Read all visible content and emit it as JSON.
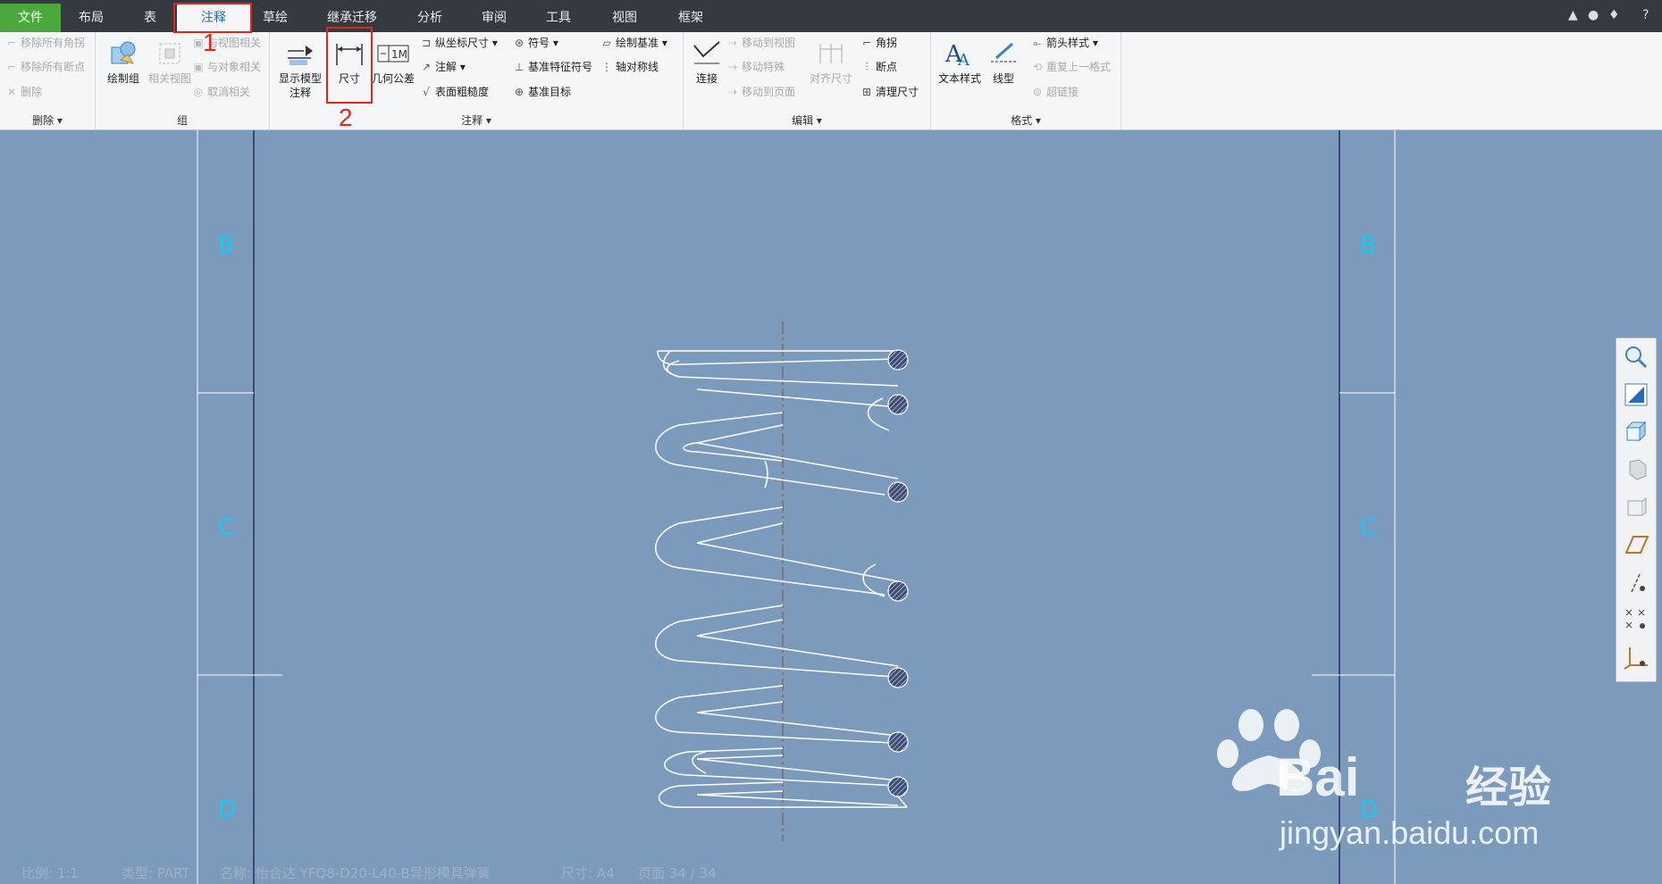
{
  "tabs": [
    "文件",
    "布局",
    "表",
    "注释",
    "草绘",
    "继承迁移",
    "分析",
    "审阅",
    "工具",
    "视图",
    "框架"
  ],
  "window_controls": [
    "▲",
    "●",
    "♦",
    "?"
  ],
  "ribbon": {
    "delete_group": {
      "label": "删除 ▾",
      "items": [
        "移除所有角拐",
        "移除所有断点",
        "删除"
      ]
    },
    "group_group": {
      "label": "组",
      "draw_group": "绘制组",
      "related_view": "相关视图",
      "items": [
        "与视图相关",
        "与对象相关",
        "取消相关"
      ]
    },
    "annot_group": {
      "label": "注释 ▾",
      "show_model": [
        "显示模型",
        "注释"
      ],
      "dimension": "尺寸",
      "gtol": "几何公差",
      "col1": [
        "纵坐标尺寸 ▾",
        "注解 ▾",
        "表面粗糙度"
      ],
      "col2": [
        "符号 ▾",
        "基准特征符号",
        "基准目标"
      ],
      "col3": [
        "绘制基准 ▾",
        "轴对称线"
      ]
    },
    "edit_group": {
      "label": "编辑 ▾",
      "connect": "连接",
      "col1": [
        "移动到视图",
        "移动特殊",
        "移动到页面"
      ],
      "align": "对齐尺寸",
      "col2": [
        "角拐",
        "断点",
        "清理尺寸"
      ]
    },
    "format_group": {
      "label": "格式 ▾",
      "text_style": "文本样式",
      "line_style": "线型",
      "col1": [
        "箭头样式 ▾",
        "重复上一格式",
        "超链接"
      ]
    }
  },
  "annotations": {
    "step1": "1",
    "step2": "2"
  },
  "zones": {
    "left": [
      "B",
      "C",
      "D"
    ],
    "right": [
      "B",
      "C",
      "D"
    ]
  },
  "status": {
    "scale": "比例: 1:1",
    "type": "类型: PART",
    "name": "名称: 怡合达 YFQ8-D20-L40-B异形模具弹簧",
    "size": "尺寸: A4",
    "page": "页面 34 / 34"
  },
  "watermark": {
    "brand": "Bai",
    "brand2": "经验",
    "url": "jingyan.baidu.com"
  }
}
